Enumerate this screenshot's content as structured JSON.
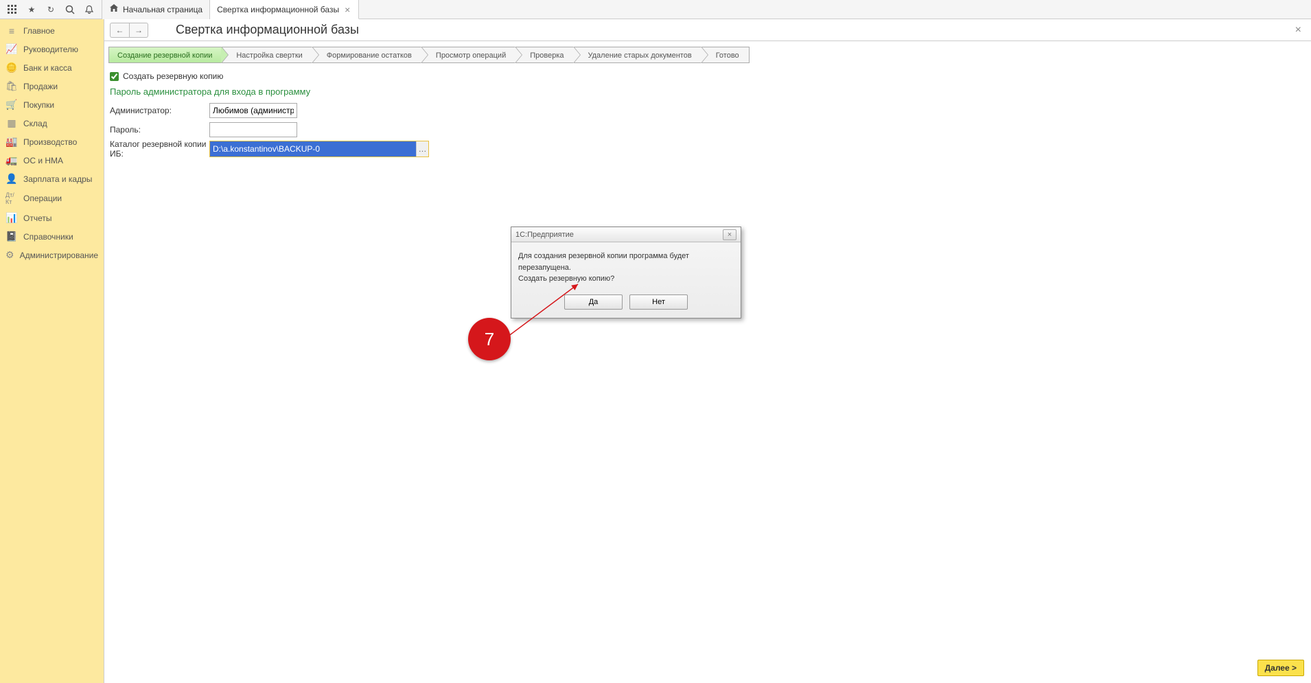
{
  "topbar": {
    "tabs": {
      "home": "Начальная страница",
      "active": "Свертка информационной базы"
    }
  },
  "sidebar": {
    "items": [
      {
        "label": "Главное",
        "icon": "≡"
      },
      {
        "label": "Руководителю",
        "icon": "📈"
      },
      {
        "label": "Банк и касса",
        "icon": "🪙"
      },
      {
        "label": "Продажи",
        "icon": "🛍"
      },
      {
        "label": "Покупки",
        "icon": "🛒"
      },
      {
        "label": "Склад",
        "icon": "▦"
      },
      {
        "label": "Производство",
        "icon": "🏭"
      },
      {
        "label": "ОС и НМА",
        "icon": "🚛"
      },
      {
        "label": "Зарплата и кадры",
        "icon": "👤"
      },
      {
        "label": "Операции",
        "icon": "Дт/Кт"
      },
      {
        "label": "Отчеты",
        "icon": "📊"
      },
      {
        "label": "Справочники",
        "icon": "📓"
      },
      {
        "label": "Администрирование",
        "icon": "⚙"
      }
    ]
  },
  "page": {
    "title": "Свертка информационной базы",
    "steps": [
      "Создание резервной копии",
      "Настройка свертки",
      "Формирование остатков",
      "Просмотр операций",
      "Проверка",
      "Удаление старых документов",
      "Готово"
    ],
    "checkbox_label": "Создать резервную копию",
    "section_title": "Пароль администратора для входа в программу",
    "admin_label": "Администратор:",
    "admin_value": "Любимов (администратор)",
    "password_label": "Пароль:",
    "password_value": "",
    "catalog_label": "Каталог резервной копии ИБ:",
    "catalog_value": "D:\\a.konstantinov\\BACKUP-0",
    "next_btn": "Далее >"
  },
  "dialog": {
    "title": "1С:Предприятие",
    "message_line1": "Для создания резервной копии программа будет перезапущена.",
    "message_line2": "Создать резервную копию?",
    "yes": "Да",
    "no": "Нет"
  },
  "callout": {
    "number": "7"
  }
}
